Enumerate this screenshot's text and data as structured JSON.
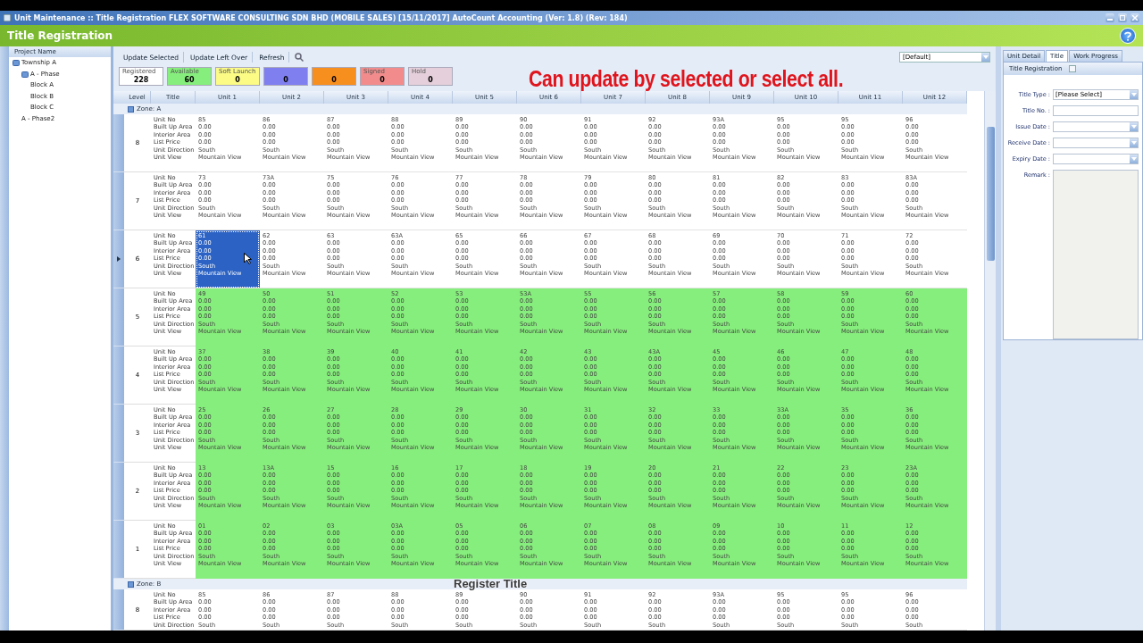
{
  "window": {
    "title": "Unit Maintenance :: Title Registration  FLEX SOFTWARE CONSULTING SDN BHD (MOBILE SALES) [15/11/2017]  AutoCount Accounting (Ver: 1.8) (Rev: 184)"
  },
  "header": {
    "title": "Title Registration"
  },
  "project_tree": {
    "heading": "Project Name",
    "items": [
      {
        "label": "Township A",
        "children": [
          {
            "label": "A - Phase",
            "children": [
              {
                "label": "Block A"
              },
              {
                "label": "Block B"
              },
              {
                "label": "Block C"
              }
            ]
          },
          {
            "label": "A - Phase2"
          }
        ]
      }
    ]
  },
  "toolbar": [
    "Update Selected",
    "Update Left Over",
    "Refresh"
  ],
  "layout_select": {
    "value": "[Default]"
  },
  "counters": [
    {
      "label": "Registered",
      "value": "228",
      "color": "#ffffff"
    },
    {
      "label": "Available",
      "value": "60",
      "color": "#86ee7c"
    },
    {
      "label": "Soft Launch",
      "value": "0",
      "color": "#fbfb86"
    },
    {
      "value": "0",
      "color": "#7f7ff0"
    },
    {
      "value": "0",
      "color": "#f78f1e"
    },
    {
      "label": "Signed",
      "value": "0",
      "color": "#f28c8c"
    },
    {
      "label": "Hold",
      "value": "0",
      "color": "#e4cfda"
    }
  ],
  "grid": {
    "columns": [
      "Level",
      "Title",
      "Unit 1",
      "Unit 2",
      "Unit 3",
      "Unit 4",
      "Unit 5",
      "Unit 6",
      "Unit 7",
      "Unit 8",
      "Unit 9",
      "Unit 10",
      "Unit 11",
      "Unit 12"
    ],
    "zones": [
      {
        "label": "Zone: A",
        "levels": [
          {
            "level": "8",
            "available": false,
            "labels": [
              "Unit No",
              "Built Up Area",
              "Interior Area",
              "List Price",
              "Unit Direction",
              "Unit View"
            ],
            "units": [
              {
                "values": [
                  "85",
                  "0.00",
                  "0.00",
                  "0.00",
                  "South",
                  "Mountain View"
                ],
                "selected": false
              },
              {
                "values": [
                  "86",
                  "0.00",
                  "0.00",
                  "0.00",
                  "South",
                  "Mountain View"
                ],
                "selected": false
              },
              {
                "values": [
                  "87",
                  "0.00",
                  "0.00",
                  "0.00",
                  "South",
                  "Mountain View"
                ],
                "selected": false
              },
              {
                "values": [
                  "88",
                  "0.00",
                  "0.00",
                  "0.00",
                  "South",
                  "Mountain View"
                ],
                "selected": false
              },
              {
                "values": [
                  "89",
                  "0.00",
                  "0.00",
                  "0.00",
                  "South",
                  "Mountain View"
                ],
                "selected": false
              },
              {
                "values": [
                  "90",
                  "0.00",
                  "0.00",
                  "0.00",
                  "South",
                  "Mountain View"
                ],
                "selected": false
              },
              {
                "values": [
                  "91",
                  "0.00",
                  "0.00",
                  "0.00",
                  "South",
                  "Mountain View"
                ],
                "selected": false
              },
              {
                "values": [
                  "92",
                  "0.00",
                  "0.00",
                  "0.00",
                  "South",
                  "Mountain View"
                ],
                "selected": false
              },
              {
                "values": [
                  "93A",
                  "0.00",
                  "0.00",
                  "0.00",
                  "South",
                  "Mountain View"
                ],
                "selected": false
              },
              {
                "values": [
                  "95",
                  "0.00",
                  "0.00",
                  "0.00",
                  "South",
                  "Mountain View"
                ],
                "selected": false
              },
              {
                "values": [
                  "95",
                  "0.00",
                  "0.00",
                  "0.00",
                  "South",
                  "Mountain View"
                ],
                "selected": false
              },
              {
                "values": [
                  "96",
                  "0.00",
                  "0.00",
                  "0.00",
                  "South",
                  "Mountain View"
                ],
                "selected": false
              }
            ]
          },
          {
            "level": "7",
            "available": false,
            "labels": [
              "Unit No",
              "Built Up Area",
              "Interior Area",
              "List Price",
              "Unit Direction",
              "Unit View"
            ],
            "units": [
              {
                "values": [
                  "73",
                  "0.00",
                  "0.00",
                  "0.00",
                  "South",
                  "Mountain View"
                ],
                "selected": false
              },
              {
                "values": [
                  "73A",
                  "0.00",
                  "0.00",
                  "0.00",
                  "South",
                  "Mountain View"
                ],
                "selected": false
              },
              {
                "values": [
                  "75",
                  "0.00",
                  "0.00",
                  "0.00",
                  "South",
                  "Mountain View"
                ],
                "selected": false
              },
              {
                "values": [
                  "76",
                  "0.00",
                  "0.00",
                  "0.00",
                  "South",
                  "Mountain View"
                ],
                "selected": false
              },
              {
                "values": [
                  "77",
                  "0.00",
                  "0.00",
                  "0.00",
                  "South",
                  "Mountain View"
                ],
                "selected": false
              },
              {
                "values": [
                  "78",
                  "0.00",
                  "0.00",
                  "0.00",
                  "South",
                  "Mountain View"
                ],
                "selected": false
              },
              {
                "values": [
                  "79",
                  "0.00",
                  "0.00",
                  "0.00",
                  "South",
                  "Mountain View"
                ],
                "selected": false
              },
              {
                "values": [
                  "80",
                  "0.00",
                  "0.00",
                  "0.00",
                  "South",
                  "Mountain View"
                ],
                "selected": false
              },
              {
                "values": [
                  "81",
                  "0.00",
                  "0.00",
                  "0.00",
                  "South",
                  "Mountain View"
                ],
                "selected": false
              },
              {
                "values": [
                  "82",
                  "0.00",
                  "0.00",
                  "0.00",
                  "South",
                  "Mountain View"
                ],
                "selected": false
              },
              {
                "values": [
                  "83",
                  "0.00",
                  "0.00",
                  "0.00",
                  "South",
                  "Mountain View"
                ],
                "selected": false
              },
              {
                "values": [
                  "83A",
                  "0.00",
                  "0.00",
                  "0.00",
                  "South",
                  "Mountain View"
                ],
                "selected": false
              }
            ]
          },
          {
            "level": "6",
            "available": false,
            "labels": [
              "Unit No",
              "Built Up Area",
              "Interior Area",
              "List Price",
              "Unit Direction",
              "Unit View"
            ],
            "units": [
              {
                "values": [
                  "61",
                  "0.00",
                  "0.00",
                  "0.00",
                  "South",
                  "Mountain View"
                ],
                "selected": true
              },
              {
                "values": [
                  "62",
                  "0.00",
                  "0.00",
                  "0.00",
                  "South",
                  "Mountain View"
                ],
                "selected": false
              },
              {
                "values": [
                  "63",
                  "0.00",
                  "0.00",
                  "0.00",
                  "South",
                  "Mountain View"
                ],
                "selected": false
              },
              {
                "values": [
                  "63A",
                  "0.00",
                  "0.00",
                  "0.00",
                  "South",
                  "Mountain View"
                ],
                "selected": false
              },
              {
                "values": [
                  "65",
                  "0.00",
                  "0.00",
                  "0.00",
                  "South",
                  "Mountain View"
                ],
                "selected": false
              },
              {
                "values": [
                  "66",
                  "0.00",
                  "0.00",
                  "0.00",
                  "South",
                  "Mountain View"
                ],
                "selected": false
              },
              {
                "values": [
                  "67",
                  "0.00",
                  "0.00",
                  "0.00",
                  "South",
                  "Mountain View"
                ],
                "selected": false
              },
              {
                "values": [
                  "68",
                  "0.00",
                  "0.00",
                  "0.00",
                  "South",
                  "Mountain View"
                ],
                "selected": false
              },
              {
                "values": [
                  "69",
                  "0.00",
                  "0.00",
                  "0.00",
                  "South",
                  "Mountain View"
                ],
                "selected": false
              },
              {
                "values": [
                  "70",
                  "0.00",
                  "0.00",
                  "0.00",
                  "South",
                  "Mountain View"
                ],
                "selected": false
              },
              {
                "values": [
                  "71",
                  "0.00",
                  "0.00",
                  "0.00",
                  "South",
                  "Mountain View"
                ],
                "selected": false
              },
              {
                "values": [
                  "72",
                  "0.00",
                  "0.00",
                  "0.00",
                  "South",
                  "Mountain View"
                ],
                "selected": false
              }
            ]
          },
          {
            "level": "5",
            "available": true,
            "labels": [
              "Unit No",
              "Built Up Area",
              "Interior Area",
              "List Price",
              "Unit Direction",
              "Unit View"
            ],
            "units": [
              {
                "values": [
                  "49",
                  "0.00",
                  "0.00",
                  "0.00",
                  "South",
                  "Mountain View"
                ],
                "selected": false
              },
              {
                "values": [
                  "50",
                  "0.00",
                  "0.00",
                  "0.00",
                  "South",
                  "Mountain View"
                ],
                "selected": false
              },
              {
                "values": [
                  "51",
                  "0.00",
                  "0.00",
                  "0.00",
                  "South",
                  "Mountain View"
                ],
                "selected": false
              },
              {
                "values": [
                  "52",
                  "0.00",
                  "0.00",
                  "0.00",
                  "South",
                  "Mountain View"
                ],
                "selected": false
              },
              {
                "values": [
                  "53",
                  "0.00",
                  "0.00",
                  "0.00",
                  "South",
                  "Mountain View"
                ],
                "selected": false
              },
              {
                "values": [
                  "53A",
                  "0.00",
                  "0.00",
                  "0.00",
                  "South",
                  "Mountain View"
                ],
                "selected": false
              },
              {
                "values": [
                  "55",
                  "0.00",
                  "0.00",
                  "0.00",
                  "South",
                  "Mountain View"
                ],
                "selected": false
              },
              {
                "values": [
                  "56",
                  "0.00",
                  "0.00",
                  "0.00",
                  "South",
                  "Mountain View"
                ],
                "selected": false
              },
              {
                "values": [
                  "57",
                  "0.00",
                  "0.00",
                  "0.00",
                  "South",
                  "Mountain View"
                ],
                "selected": false
              },
              {
                "values": [
                  "58",
                  "0.00",
                  "0.00",
                  "0.00",
                  "South",
                  "Mountain View"
                ],
                "selected": false
              },
              {
                "values": [
                  "59",
                  "0.00",
                  "0.00",
                  "0.00",
                  "South",
                  "Mountain View"
                ],
                "selected": false
              },
              {
                "values": [
                  "60",
                  "0.00",
                  "0.00",
                  "0.00",
                  "South",
                  "Mountain View"
                ],
                "selected": false
              }
            ]
          },
          {
            "level": "4",
            "available": true,
            "labels": [
              "Unit No",
              "Built Up Area",
              "Interior Area",
              "List Price",
              "Unit Direction",
              "Unit View"
            ],
            "units": [
              {
                "values": [
                  "37",
                  "0.00",
                  "0.00",
                  "0.00",
                  "South",
                  "Mountain View"
                ],
                "selected": false
              },
              {
                "values": [
                  "38",
                  "0.00",
                  "0.00",
                  "0.00",
                  "South",
                  "Mountain View"
                ],
                "selected": false
              },
              {
                "values": [
                  "39",
                  "0.00",
                  "0.00",
                  "0.00",
                  "South",
                  "Mountain View"
                ],
                "selected": false
              },
              {
                "values": [
                  "40",
                  "0.00",
                  "0.00",
                  "0.00",
                  "South",
                  "Mountain View"
                ],
                "selected": false
              },
              {
                "values": [
                  "41",
                  "0.00",
                  "0.00",
                  "0.00",
                  "South",
                  "Mountain View"
                ],
                "selected": false
              },
              {
                "values": [
                  "42",
                  "0.00",
                  "0.00",
                  "0.00",
                  "South",
                  "Mountain View"
                ],
                "selected": false
              },
              {
                "values": [
                  "43",
                  "0.00",
                  "0.00",
                  "0.00",
                  "South",
                  "Mountain View"
                ],
                "selected": false
              },
              {
                "values": [
                  "43A",
                  "0.00",
                  "0.00",
                  "0.00",
                  "South",
                  "Mountain View"
                ],
                "selected": false
              },
              {
                "values": [
                  "45",
                  "0.00",
                  "0.00",
                  "0.00",
                  "South",
                  "Mountain View"
                ],
                "selected": false
              },
              {
                "values": [
                  "46",
                  "0.00",
                  "0.00",
                  "0.00",
                  "South",
                  "Mountain View"
                ],
                "selected": false
              },
              {
                "values": [
                  "47",
                  "0.00",
                  "0.00",
                  "0.00",
                  "South",
                  "Mountain View"
                ],
                "selected": false
              },
              {
                "values": [
                  "48",
                  "0.00",
                  "0.00",
                  "0.00",
                  "South",
                  "Mountain View"
                ],
                "selected": false
              }
            ]
          },
          {
            "level": "3",
            "available": true,
            "labels": [
              "Unit No",
              "Built Up Area",
              "Interior Area",
              "List Price",
              "Unit Direction",
              "Unit View"
            ],
            "units": [
              {
                "values": [
                  "25",
                  "0.00",
                  "0.00",
                  "0.00",
                  "South",
                  "Mountain View"
                ],
                "selected": false
              },
              {
                "values": [
                  "26",
                  "0.00",
                  "0.00",
                  "0.00",
                  "South",
                  "Mountain View"
                ],
                "selected": false
              },
              {
                "values": [
                  "27",
                  "0.00",
                  "0.00",
                  "0.00",
                  "South",
                  "Mountain View"
                ],
                "selected": false
              },
              {
                "values": [
                  "28",
                  "0.00",
                  "0.00",
                  "0.00",
                  "South",
                  "Mountain View"
                ],
                "selected": false
              },
              {
                "values": [
                  "29",
                  "0.00",
                  "0.00",
                  "0.00",
                  "South",
                  "Mountain View"
                ],
                "selected": false
              },
              {
                "values": [
                  "30",
                  "0.00",
                  "0.00",
                  "0.00",
                  "South",
                  "Mountain View"
                ],
                "selected": false
              },
              {
                "values": [
                  "31",
                  "0.00",
                  "0.00",
                  "0.00",
                  "South",
                  "Mountain View"
                ],
                "selected": false
              },
              {
                "values": [
                  "32",
                  "0.00",
                  "0.00",
                  "0.00",
                  "South",
                  "Mountain View"
                ],
                "selected": false
              },
              {
                "values": [
                  "33",
                  "0.00",
                  "0.00",
                  "0.00",
                  "South",
                  "Mountain View"
                ],
                "selected": false
              },
              {
                "values": [
                  "33A",
                  "0.00",
                  "0.00",
                  "0.00",
                  "South",
                  "Mountain View"
                ],
                "selected": false
              },
              {
                "values": [
                  "35",
                  "0.00",
                  "0.00",
                  "0.00",
                  "South",
                  "Mountain View"
                ],
                "selected": false
              },
              {
                "values": [
                  "36",
                  "0.00",
                  "0.00",
                  "0.00",
                  "South",
                  "Mountain View"
                ],
                "selected": false
              }
            ]
          },
          {
            "level": "2",
            "available": true,
            "labels": [
              "Unit No",
              "Built Up Area",
              "Interior Area",
              "List Price",
              "Unit Direction",
              "Unit View"
            ],
            "units": [
              {
                "values": [
                  "13",
                  "0.00",
                  "0.00",
                  "0.00",
                  "South",
                  "Mountain View"
                ],
                "selected": false
              },
              {
                "values": [
                  "13A",
                  "0.00",
                  "0.00",
                  "0.00",
                  "South",
                  "Mountain View"
                ],
                "selected": false
              },
              {
                "values": [
                  "15",
                  "0.00",
                  "0.00",
                  "0.00",
                  "South",
                  "Mountain View"
                ],
                "selected": false
              },
              {
                "values": [
                  "16",
                  "0.00",
                  "0.00",
                  "0.00",
                  "South",
                  "Mountain View"
                ],
                "selected": false
              },
              {
                "values": [
                  "17",
                  "0.00",
                  "0.00",
                  "0.00",
                  "South",
                  "Mountain View"
                ],
                "selected": false
              },
              {
                "values": [
                  "18",
                  "0.00",
                  "0.00",
                  "0.00",
                  "South",
                  "Mountain View"
                ],
                "selected": false
              },
              {
                "values": [
                  "19",
                  "0.00",
                  "0.00",
                  "0.00",
                  "South",
                  "Mountain View"
                ],
                "selected": false
              },
              {
                "values": [
                  "20",
                  "0.00",
                  "0.00",
                  "0.00",
                  "South",
                  "Mountain View"
                ],
                "selected": false
              },
              {
                "values": [
                  "21",
                  "0.00",
                  "0.00",
                  "0.00",
                  "South",
                  "Mountain View"
                ],
                "selected": false
              },
              {
                "values": [
                  "22",
                  "0.00",
                  "0.00",
                  "0.00",
                  "South",
                  "Mountain View"
                ],
                "selected": false
              },
              {
                "values": [
                  "23",
                  "0.00",
                  "0.00",
                  "0.00",
                  "South",
                  "Mountain View"
                ],
                "selected": false
              },
              {
                "values": [
                  "23A",
                  "0.00",
                  "0.00",
                  "0.00",
                  "South",
                  "Mountain View"
                ],
                "selected": false
              }
            ]
          },
          {
            "level": "1",
            "available": true,
            "labels": [
              "Unit No",
              "Built Up Area",
              "Interior Area",
              "List Price",
              "Unit Direction",
              "Unit View"
            ],
            "units": [
              {
                "values": [
                  "01",
                  "0.00",
                  "0.00",
                  "0.00",
                  "South",
                  "Mountain View"
                ],
                "selected": false
              },
              {
                "values": [
                  "02",
                  "0.00",
                  "0.00",
                  "0.00",
                  "South",
                  "Mountain View"
                ],
                "selected": false
              },
              {
                "values": [
                  "03",
                  "0.00",
                  "0.00",
                  "0.00",
                  "South",
                  "Mountain View"
                ],
                "selected": false
              },
              {
                "values": [
                  "03A",
                  "0.00",
                  "0.00",
                  "0.00",
                  "South",
                  "Mountain View"
                ],
                "selected": false
              },
              {
                "values": [
                  "05",
                  "0.00",
                  "0.00",
                  "0.00",
                  "South",
                  "Mountain View"
                ],
                "selected": false
              },
              {
                "values": [
                  "06",
                  "0.00",
                  "0.00",
                  "0.00",
                  "South",
                  "Mountain View"
                ],
                "selected": false
              },
              {
                "values": [
                  "07",
                  "0.00",
                  "0.00",
                  "0.00",
                  "South",
                  "Mountain View"
                ],
                "selected": false
              },
              {
                "values": [
                  "08",
                  "0.00",
                  "0.00",
                  "0.00",
                  "South",
                  "Mountain View"
                ],
                "selected": false
              },
              {
                "values": [
                  "09",
                  "0.00",
                  "0.00",
                  "0.00",
                  "South",
                  "Mountain View"
                ],
                "selected": false
              },
              {
                "values": [
                  "10",
                  "0.00",
                  "0.00",
                  "0.00",
                  "South",
                  "Mountain View"
                ],
                "selected": false
              },
              {
                "values": [
                  "11",
                  "0.00",
                  "0.00",
                  "0.00",
                  "South",
                  "Mountain View"
                ],
                "selected": false
              },
              {
                "values": [
                  "12",
                  "0.00",
                  "0.00",
                  "0.00",
                  "South",
                  "Mountain View"
                ],
                "selected": false
              }
            ]
          }
        ]
      },
      {
        "label": "Zone: B",
        "levels": [
          {
            "level": "8",
            "available": false,
            "labels": [
              "Unit No",
              "Built Up Area",
              "Interior Area",
              "List Price",
              "Unit Direction"
            ],
            "units": [
              {
                "values": [
                  "85",
                  "0.00",
                  "0.00",
                  "0.00",
                  "South"
                ],
                "selected": false
              },
              {
                "values": [
                  "86",
                  "0.00",
                  "0.00",
                  "0.00",
                  "South"
                ],
                "selected": false
              },
              {
                "values": [
                  "87",
                  "0.00",
                  "0.00",
                  "0.00",
                  "South"
                ],
                "selected": false
              },
              {
                "values": [
                  "88",
                  "0.00",
                  "0.00",
                  "0.00",
                  "South"
                ],
                "selected": false
              },
              {
                "values": [
                  "89",
                  "0.00",
                  "0.00",
                  "0.00",
                  "South"
                ],
                "selected": false
              },
              {
                "values": [
                  "90",
                  "0.00",
                  "0.00",
                  "0.00",
                  "South"
                ],
                "selected": false
              },
              {
                "values": [
                  "91",
                  "0.00",
                  "0.00",
                  "0.00",
                  "South"
                ],
                "selected": false
              },
              {
                "values": [
                  "92",
                  "0.00",
                  "0.00",
                  "0.00",
                  "South"
                ],
                "selected": false
              },
              {
                "values": [
                  "93A",
                  "0.00",
                  "0.00",
                  "0.00",
                  "South"
                ],
                "selected": false
              },
              {
                "values": [
                  "95",
                  "0.00",
                  "0.00",
                  "0.00",
                  "South"
                ],
                "selected": false
              },
              {
                "values": [
                  "95",
                  "0.00",
                  "0.00",
                  "0.00",
                  "South"
                ],
                "selected": false
              },
              {
                "values": [
                  "96",
                  "0.00",
                  "0.00",
                  "0.00",
                  "South"
                ],
                "selected": false
              }
            ]
          }
        ]
      }
    ]
  },
  "detail_panel": {
    "tabs": [
      {
        "label": "Unit Detail",
        "selected": false
      },
      {
        "label": "Title",
        "selected": true
      },
      {
        "label": "Work Progress",
        "selected": false
      }
    ],
    "group": {
      "title": "Title Registration",
      "checked": false
    },
    "fields": [
      {
        "label": "Title Type :",
        "kind": "select",
        "value": "[Please Select]"
      },
      {
        "label": "Title No. :",
        "kind": "text"
      },
      {
        "label": "Issue Date :",
        "kind": "date"
      },
      {
        "label": "Receive Date :",
        "kind": "date"
      },
      {
        "label": "Expiry Date :",
        "kind": "date"
      },
      {
        "label": "Remark :",
        "kind": "memo"
      }
    ]
  },
  "captions": [
    {
      "text": "Can update by selected or select all.",
      "kind": "headline"
    },
    {
      "text": "Register Title",
      "kind": "subtitle"
    }
  ]
}
